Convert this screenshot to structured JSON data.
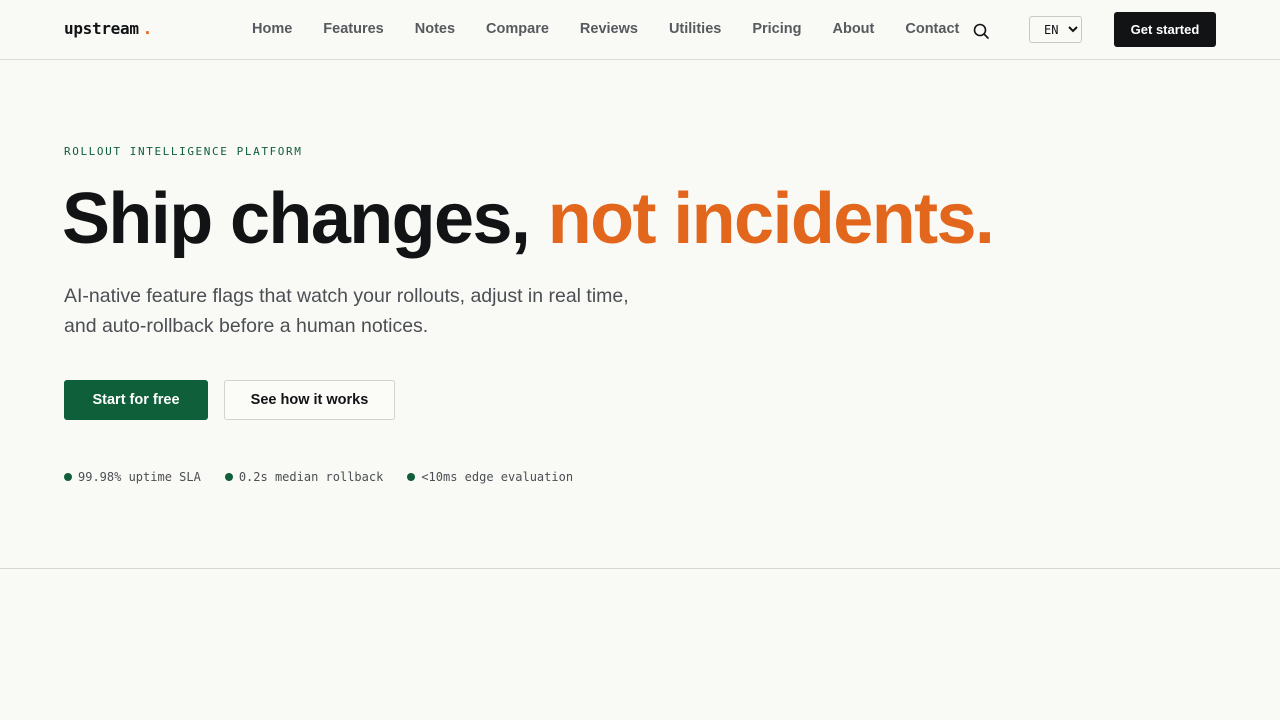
{
  "brand": {
    "name": "upstream",
    "dot": ".",
    "accent_color": "#e2661b",
    "primary_color": "#0f5f3a"
  },
  "nav": {
    "links": [
      "Home",
      "Features",
      "Notes",
      "Compare",
      "Reviews",
      "Utilities",
      "Pricing",
      "About",
      "Contact"
    ],
    "search_icon": "search-icon",
    "language": {
      "selected": "EN"
    },
    "cta_label": "Get started"
  },
  "hero": {
    "eyebrow": "ROLLOUT INTELLIGENCE PLATFORM",
    "headline_main": "Ship changes,",
    "headline_accent": "not incidents.",
    "subhead": "AI-native feature flags that watch your rollouts, adjust in real time, and auto-rollback before a human notices.",
    "primary_button": "Start for free",
    "secondary_button": "See how it works",
    "stats": [
      "99.98% uptime SLA",
      "0.2s median rollback",
      "<10ms edge evaluation"
    ]
  }
}
